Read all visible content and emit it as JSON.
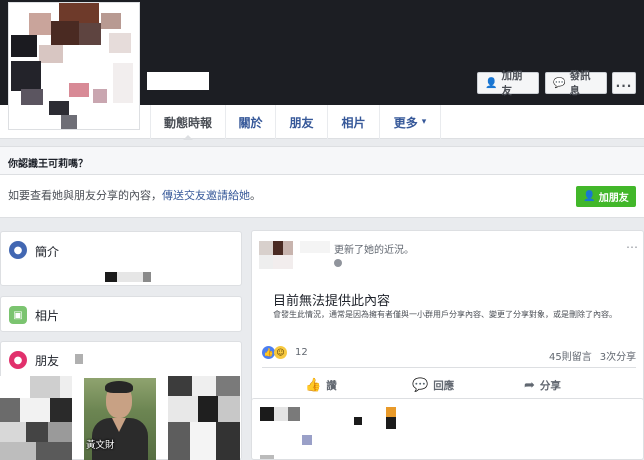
{
  "header": {
    "buttons": {
      "add_friend": "加朋友",
      "message": "發訊息",
      "more": "..."
    },
    "tabs": [
      {
        "label": "動態時報"
      },
      {
        "label": "關於"
      },
      {
        "label": "朋友"
      },
      {
        "label": "相片"
      },
      {
        "label": "更多"
      }
    ],
    "more_caret": "▾"
  },
  "friend_prompt": {
    "heading": "你認識王可莉嗎？",
    "text": "如要查看她與朋友分享的內容，",
    "link": "傳送交友邀請給她",
    "text_end": "。",
    "button": "加朋友"
  },
  "left": {
    "intro": {
      "title": "簡介",
      "icon": "globe-icon"
    },
    "photos": {
      "title": "相片",
      "icon": "photo-icon"
    },
    "friends": {
      "title": "朋友",
      "icon": "friends-icon",
      "visible_friend_name": "黃文財"
    }
  },
  "post": {
    "action_text": "更新了她的近況。",
    "unavailable_title": "目前無法提供此內容",
    "unavailable_desc": "會發生此情況，通常是因為擁有者僅與一小群用戶分享內容、變更了分享對象，或是刪除了內容。",
    "reaction_count": "12",
    "comments": "45則留言",
    "shares": "3次分享",
    "actions": {
      "like": "讚",
      "comment": "回應",
      "share": "分享"
    },
    "colors": {
      "like": "#4c7ff0",
      "haha": "#f7c940"
    }
  },
  "colors": {
    "cover": "#1c1e23",
    "link": "#365899",
    "green": "#42b72a",
    "page_bg": "#e9ebee"
  }
}
